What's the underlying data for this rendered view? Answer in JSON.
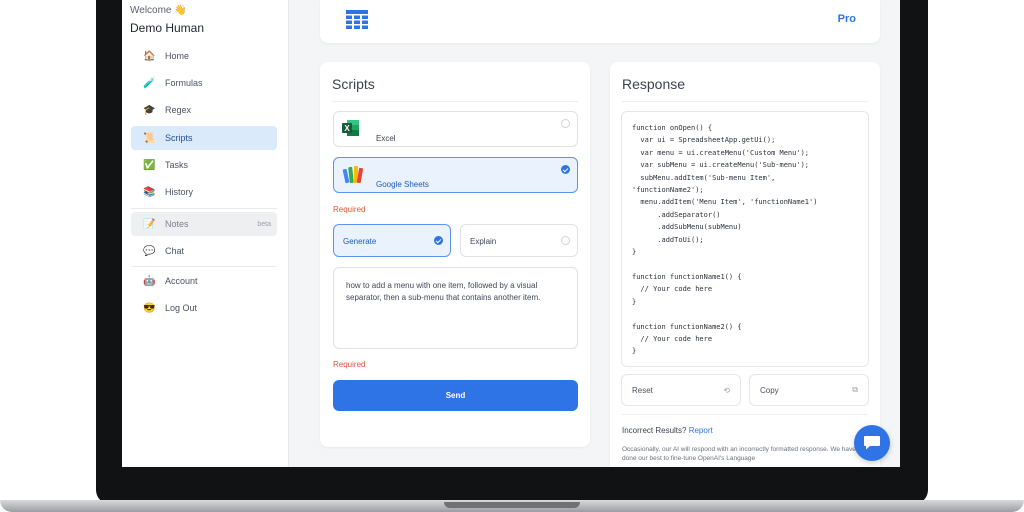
{
  "sidebar": {
    "welcome": "Welcome 👋",
    "username": "Demo Human",
    "items": [
      {
        "label": "Home",
        "icon": "🏠"
      },
      {
        "label": "Formulas",
        "icon": "🧪"
      },
      {
        "label": "Regex",
        "icon": "🎓"
      },
      {
        "label": "Scripts",
        "icon": "📜"
      },
      {
        "label": "Tasks",
        "icon": "✅"
      },
      {
        "label": "History",
        "icon": "📚"
      },
      {
        "label": "Notes",
        "icon": "📝",
        "badge": "beta"
      },
      {
        "label": "Chat",
        "icon": "💬"
      },
      {
        "label": "Account",
        "icon": "🤖"
      },
      {
        "label": "Log Out",
        "icon": "😎"
      }
    ]
  },
  "header": {
    "pro_label": "Pro"
  },
  "scripts": {
    "title": "Scripts",
    "options": [
      {
        "label": "Excel"
      },
      {
        "label": "Google Sheets"
      }
    ],
    "required_1": "Required",
    "modes": [
      {
        "label": "Generate"
      },
      {
        "label": "Explain"
      }
    ],
    "prompt": "how to add a menu with one item, followed by a visual separator, then a sub-menu that contains another item.",
    "required_2": "Required",
    "send_label": "Send"
  },
  "response": {
    "title": "Response",
    "code": "function onOpen() {\n  var ui = SpreadsheetApp.getUi();\n  var menu = ui.createMenu('Custom Menu');\n  var subMenu = ui.createMenu('Sub-menu');\n  subMenu.addItem('Sub-menu Item',\n'functionName2');\n  menu.addItem('Menu Item', 'functionName1')\n      .addSeparator()\n      .addSubMenu(subMenu)\n      .addToUi();\n}\n\nfunction functionName1() {\n  // Your code here\n}\n\nfunction functionName2() {\n  // Your code here\n}",
    "reset_label": "Reset",
    "copy_label": "Copy",
    "incorrect_text": "Incorrect Results?",
    "report_link": "Report",
    "disclaimer": "Occasionally, our AI will respond with an incorrectly formatted response. We have done our best to fine-tune OpenAI's Language"
  },
  "colors": {
    "accent": "#2f74e6",
    "required": "#e0533d",
    "active_nav_bg": "#dbeafb"
  }
}
